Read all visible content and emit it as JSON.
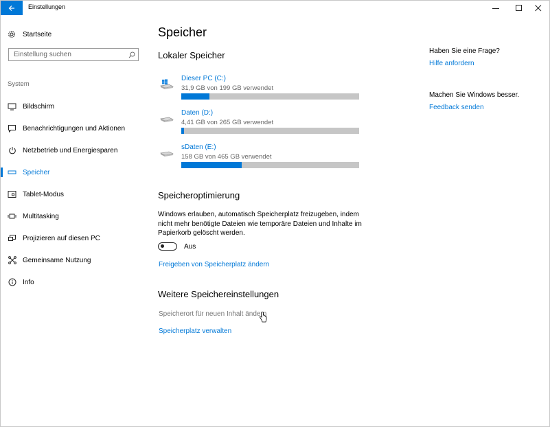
{
  "window": {
    "title": "Einstellungen"
  },
  "sidebar": {
    "home_label": "Startseite",
    "search_placeholder": "Einstellung suchen",
    "section_label": "System",
    "items": [
      {
        "label": "Bildschirm",
        "icon": "monitor-icon"
      },
      {
        "label": "Benachrichtigungen und Aktionen",
        "icon": "notification-icon"
      },
      {
        "label": "Netzbetrieb und Energiesparen",
        "icon": "power-icon"
      },
      {
        "label": "Speicher",
        "icon": "storage-icon",
        "active": true
      },
      {
        "label": "Tablet-Modus",
        "icon": "tablet-icon"
      },
      {
        "label": "Multitasking",
        "icon": "multitasking-icon"
      },
      {
        "label": "Projizieren auf diesen PC",
        "icon": "project-icon"
      },
      {
        "label": "Gemeinsame Nutzung",
        "icon": "share-icon"
      },
      {
        "label": "Info",
        "icon": "info-icon"
      }
    ]
  },
  "main": {
    "title": "Speicher",
    "local_storage_heading": "Lokaler Speicher",
    "drives": [
      {
        "name": "Dieser PC (C:)",
        "usage": "31,9 GB von 199 GB verwendet",
        "fraction": 0.16,
        "icon": "windows-drive-icon"
      },
      {
        "name": "Daten (D:)",
        "usage": "4,41 GB von 265 GB verwendet",
        "fraction": 0.017,
        "icon": "hard-drive-icon"
      },
      {
        "name": "sDaten (E:)",
        "usage": "158 GB von 465 GB verwendet",
        "fraction": 0.34,
        "icon": "hard-drive-icon"
      }
    ],
    "optimization_heading": "Speicheroptimierung",
    "optimization_text": "Windows erlauben, automatisch Speicherplatz freizugeben, indem nicht mehr benötigte Dateien wie temporäre Dateien und Inhalte im Papierkorb gelöscht werden.",
    "toggle_state": "Aus",
    "change_freeing_link": "Freigeben von Speicherplatz ändern",
    "more_heading": "Weitere Speichereinstellungen",
    "save_location_text": "Speicherort für neuen Inhalt ändern",
    "manage_storage_link": "Speicherplatz verwalten"
  },
  "right": {
    "question": "Haben Sie eine Frage?",
    "help_link": "Hilfe anfordern",
    "improve": "Machen Sie Windows besser.",
    "feedback_link": "Feedback senden"
  },
  "colors": {
    "accent": "#0078d7",
    "track": "#c6c6c6"
  }
}
